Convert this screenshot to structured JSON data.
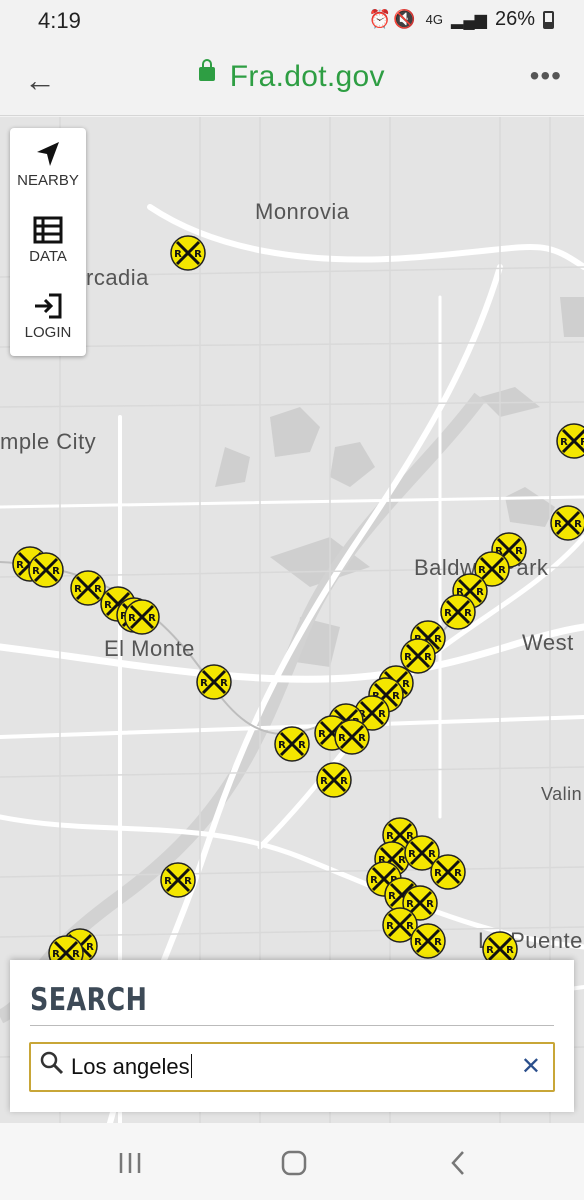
{
  "status": {
    "time": "4:19",
    "signal": "4G",
    "battery": "26%"
  },
  "browser": {
    "url": "Fra.dot.gov"
  },
  "toolbox": {
    "nearby_label": "NEARBY",
    "data_label": "DATA",
    "login_label": "LOGIN"
  },
  "map": {
    "labels": {
      "monrovia": "Monrovia",
      "arcadia": "rcadia",
      "temple_city": "mple City",
      "baldwin_park": "Baldwin Park",
      "el_monte": "El Monte",
      "west": "West",
      "valin": "Valin",
      "la_puente": "La Puente"
    },
    "marker_icon": "railroad-crossing-icon",
    "marker_text": "R"
  },
  "search": {
    "title": "SEARCH",
    "value": "Los angeles"
  },
  "colors": {
    "accent": "#2e9e43",
    "marker": "#f4e600",
    "search_border": "#c8a637"
  }
}
